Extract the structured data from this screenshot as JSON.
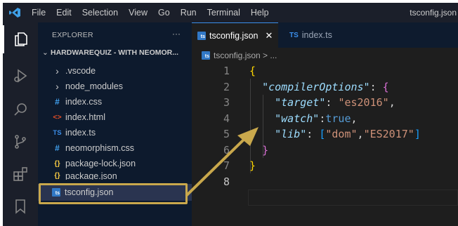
{
  "menubar": {
    "items": [
      "File",
      "Edit",
      "Selection",
      "View",
      "Go",
      "Run",
      "Terminal",
      "Help"
    ],
    "window_title": "tsconfig.json"
  },
  "activity_bar": {
    "icons": [
      "explorer-icon",
      "run-debug-icon",
      "search-icon",
      "source-control-icon",
      "extensions-icon",
      "bookmark-icon"
    ]
  },
  "sidebar": {
    "title": "EXPLORER",
    "more": "···",
    "folder": "HARDWAREQUIZ - WITH NEOMOR...",
    "items": [
      {
        "label": ".vscode",
        "icon": "›",
        "icon_color": "#cccccc"
      },
      {
        "label": "node_modules",
        "icon": "›",
        "icon_color": "#cccccc"
      },
      {
        "label": "index.css",
        "icon": "#",
        "icon_color": "#42a5f5"
      },
      {
        "label": "index.html",
        "icon": "<>",
        "icon_color": "#e44d26"
      },
      {
        "label": "index.ts",
        "icon": "TS",
        "icon_color": "#3b8eea"
      },
      {
        "label": "neomorphism.css",
        "icon": "#",
        "icon_color": "#42a5f5"
      },
      {
        "label": "package-lock.json",
        "icon": "{}",
        "icon_color": "#f5c842"
      },
      {
        "label": "package.json",
        "icon": "{}",
        "icon_color": "#f5c842"
      },
      {
        "label": "tsconfig.json",
        "icon": "ts",
        "icon_color": "#3178c6"
      }
    ]
  },
  "tabs": [
    {
      "label": "tsconfig.json",
      "close": "✕",
      "active": true
    },
    {
      "label": "index.ts",
      "active": false
    }
  ],
  "breadcrumb": "tsconfig.json > ...",
  "editor": {
    "line_numbers": [
      "1",
      "2",
      "3",
      "4",
      "5",
      "6",
      "7",
      "8"
    ],
    "current_line": "8",
    "lines": {
      "l1_open": "{",
      "l2_key": "\"compilerOptions\"",
      "l2_colon": ": ",
      "l2_open": "{",
      "l3_key": "\"target\"",
      "l3_colon": ": ",
      "l3_val": "\"es2016\"",
      "l3_comma": ",",
      "l4_key": "\"watch\"",
      "l4_colon": ":",
      "l4_val": "true",
      "l4_comma": ",",
      "l5_key": "\"lib\"",
      "l5_colon": ": ",
      "l5_open": "[",
      "l5_v1": "\"dom\"",
      "l5_comma": ",",
      "l5_v2": "\"ES2017\"",
      "l5_close": "]",
      "l6_close": "}",
      "l7_close": "}"
    }
  },
  "colors": {
    "annotation": "#c9a84c",
    "accent": "#3b8eea"
  }
}
